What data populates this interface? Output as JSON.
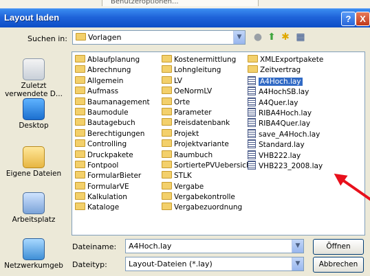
{
  "background": {
    "menu_item": "Benutzeroptionen..."
  },
  "titlebar": {
    "title": "Layout laden",
    "help": "?",
    "close": "X"
  },
  "lookin": {
    "label": "Suchen in:",
    "value": "Vorlagen"
  },
  "toolbar_icons": [
    "back-icon",
    "up-folder-icon",
    "new-folder-icon",
    "view-menu-icon"
  ],
  "places": [
    {
      "label1": "Zuletzt",
      "label2": "verwendete D...",
      "icon": "recent-documents-icon"
    },
    {
      "label1": "Desktop",
      "label2": "",
      "icon": "desktop-icon"
    },
    {
      "label1": "Eigene Dateien",
      "label2": "",
      "icon": "my-documents-icon"
    },
    {
      "label1": "Arbeitsplatz",
      "label2": "",
      "icon": "my-computer-icon"
    },
    {
      "label1": "Netzwerkumgeb",
      "label2": "",
      "icon": "network-icon"
    }
  ],
  "files": {
    "col1": [
      "Ablaufplanung",
      "Abrechnung",
      "Allgemein",
      "Aufmass",
      "Baumanagement",
      "Baumodule",
      "Bautagebuch",
      "Berechtigungen",
      "Controlling",
      "Druckpakete",
      "Fontpool",
      "FormularBieter",
      "FormularVE",
      "Kalkulation",
      "Kataloge"
    ],
    "col2": [
      "Kostenermittlung",
      "Lohngleitung",
      "LV",
      "OeNormLV",
      "Orte",
      "Parameter",
      "Preisdatenbank",
      "Projekt",
      "Projektvariante",
      "Raumbuch",
      "SortiertePVUebersicht",
      "STLK",
      "Vergabe",
      "Vergabekontrolle",
      "Vergabezuordnung"
    ],
    "col3_folders": [
      "XMLExportpakete",
      "Zeitvertrag"
    ],
    "col3_files": [
      "A4Hoch.lay",
      "A4HochSB.lay",
      "A4Quer.lay",
      "RIBA4Hoch.lay",
      "RIBA4Quer.lay",
      "save_A4Hoch.lay",
      "Standard.lay",
      "VHB222.lay",
      "VHB223_2008.lay"
    ],
    "selected": "A4Hoch.lay"
  },
  "filename": {
    "label": "Dateiname:",
    "value": "A4Hoch.lay"
  },
  "filetype": {
    "label": "Dateityp:",
    "value": "Layout-Dateien (*.lay)"
  },
  "buttons": {
    "open": "Öffnen",
    "cancel": "Abbrechen"
  },
  "colors": {
    "titlebar": "#0d4ec6",
    "selection": "#316ac5",
    "annotation_arrow": "#e8101c"
  }
}
